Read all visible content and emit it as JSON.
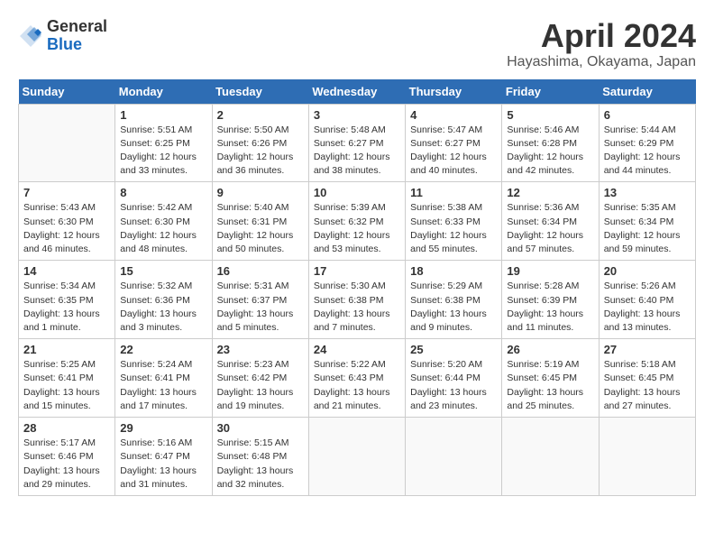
{
  "header": {
    "logo_general": "General",
    "logo_blue": "Blue",
    "month_title": "April 2024",
    "location": "Hayashima, Okayama, Japan"
  },
  "days_of_week": [
    "Sunday",
    "Monday",
    "Tuesday",
    "Wednesday",
    "Thursday",
    "Friday",
    "Saturday"
  ],
  "weeks": [
    [
      {
        "day": "",
        "info": ""
      },
      {
        "day": "1",
        "info": "Sunrise: 5:51 AM\nSunset: 6:25 PM\nDaylight: 12 hours\nand 33 minutes."
      },
      {
        "day": "2",
        "info": "Sunrise: 5:50 AM\nSunset: 6:26 PM\nDaylight: 12 hours\nand 36 minutes."
      },
      {
        "day": "3",
        "info": "Sunrise: 5:48 AM\nSunset: 6:27 PM\nDaylight: 12 hours\nand 38 minutes."
      },
      {
        "day": "4",
        "info": "Sunrise: 5:47 AM\nSunset: 6:27 PM\nDaylight: 12 hours\nand 40 minutes."
      },
      {
        "day": "5",
        "info": "Sunrise: 5:46 AM\nSunset: 6:28 PM\nDaylight: 12 hours\nand 42 minutes."
      },
      {
        "day": "6",
        "info": "Sunrise: 5:44 AM\nSunset: 6:29 PM\nDaylight: 12 hours\nand 44 minutes."
      }
    ],
    [
      {
        "day": "7",
        "info": "Sunrise: 5:43 AM\nSunset: 6:30 PM\nDaylight: 12 hours\nand 46 minutes."
      },
      {
        "day": "8",
        "info": "Sunrise: 5:42 AM\nSunset: 6:30 PM\nDaylight: 12 hours\nand 48 minutes."
      },
      {
        "day": "9",
        "info": "Sunrise: 5:40 AM\nSunset: 6:31 PM\nDaylight: 12 hours\nand 50 minutes."
      },
      {
        "day": "10",
        "info": "Sunrise: 5:39 AM\nSunset: 6:32 PM\nDaylight: 12 hours\nand 53 minutes."
      },
      {
        "day": "11",
        "info": "Sunrise: 5:38 AM\nSunset: 6:33 PM\nDaylight: 12 hours\nand 55 minutes."
      },
      {
        "day": "12",
        "info": "Sunrise: 5:36 AM\nSunset: 6:34 PM\nDaylight: 12 hours\nand 57 minutes."
      },
      {
        "day": "13",
        "info": "Sunrise: 5:35 AM\nSunset: 6:34 PM\nDaylight: 12 hours\nand 59 minutes."
      }
    ],
    [
      {
        "day": "14",
        "info": "Sunrise: 5:34 AM\nSunset: 6:35 PM\nDaylight: 13 hours\nand 1 minute."
      },
      {
        "day": "15",
        "info": "Sunrise: 5:32 AM\nSunset: 6:36 PM\nDaylight: 13 hours\nand 3 minutes."
      },
      {
        "day": "16",
        "info": "Sunrise: 5:31 AM\nSunset: 6:37 PM\nDaylight: 13 hours\nand 5 minutes."
      },
      {
        "day": "17",
        "info": "Sunrise: 5:30 AM\nSunset: 6:38 PM\nDaylight: 13 hours\nand 7 minutes."
      },
      {
        "day": "18",
        "info": "Sunrise: 5:29 AM\nSunset: 6:38 PM\nDaylight: 13 hours\nand 9 minutes."
      },
      {
        "day": "19",
        "info": "Sunrise: 5:28 AM\nSunset: 6:39 PM\nDaylight: 13 hours\nand 11 minutes."
      },
      {
        "day": "20",
        "info": "Sunrise: 5:26 AM\nSunset: 6:40 PM\nDaylight: 13 hours\nand 13 minutes."
      }
    ],
    [
      {
        "day": "21",
        "info": "Sunrise: 5:25 AM\nSunset: 6:41 PM\nDaylight: 13 hours\nand 15 minutes."
      },
      {
        "day": "22",
        "info": "Sunrise: 5:24 AM\nSunset: 6:41 PM\nDaylight: 13 hours\nand 17 minutes."
      },
      {
        "day": "23",
        "info": "Sunrise: 5:23 AM\nSunset: 6:42 PM\nDaylight: 13 hours\nand 19 minutes."
      },
      {
        "day": "24",
        "info": "Sunrise: 5:22 AM\nSunset: 6:43 PM\nDaylight: 13 hours\nand 21 minutes."
      },
      {
        "day": "25",
        "info": "Sunrise: 5:20 AM\nSunset: 6:44 PM\nDaylight: 13 hours\nand 23 minutes."
      },
      {
        "day": "26",
        "info": "Sunrise: 5:19 AM\nSunset: 6:45 PM\nDaylight: 13 hours\nand 25 minutes."
      },
      {
        "day": "27",
        "info": "Sunrise: 5:18 AM\nSunset: 6:45 PM\nDaylight: 13 hours\nand 27 minutes."
      }
    ],
    [
      {
        "day": "28",
        "info": "Sunrise: 5:17 AM\nSunset: 6:46 PM\nDaylight: 13 hours\nand 29 minutes."
      },
      {
        "day": "29",
        "info": "Sunrise: 5:16 AM\nSunset: 6:47 PM\nDaylight: 13 hours\nand 31 minutes."
      },
      {
        "day": "30",
        "info": "Sunrise: 5:15 AM\nSunset: 6:48 PM\nDaylight: 13 hours\nand 32 minutes."
      },
      {
        "day": "",
        "info": ""
      },
      {
        "day": "",
        "info": ""
      },
      {
        "day": "",
        "info": ""
      },
      {
        "day": "",
        "info": ""
      }
    ]
  ]
}
